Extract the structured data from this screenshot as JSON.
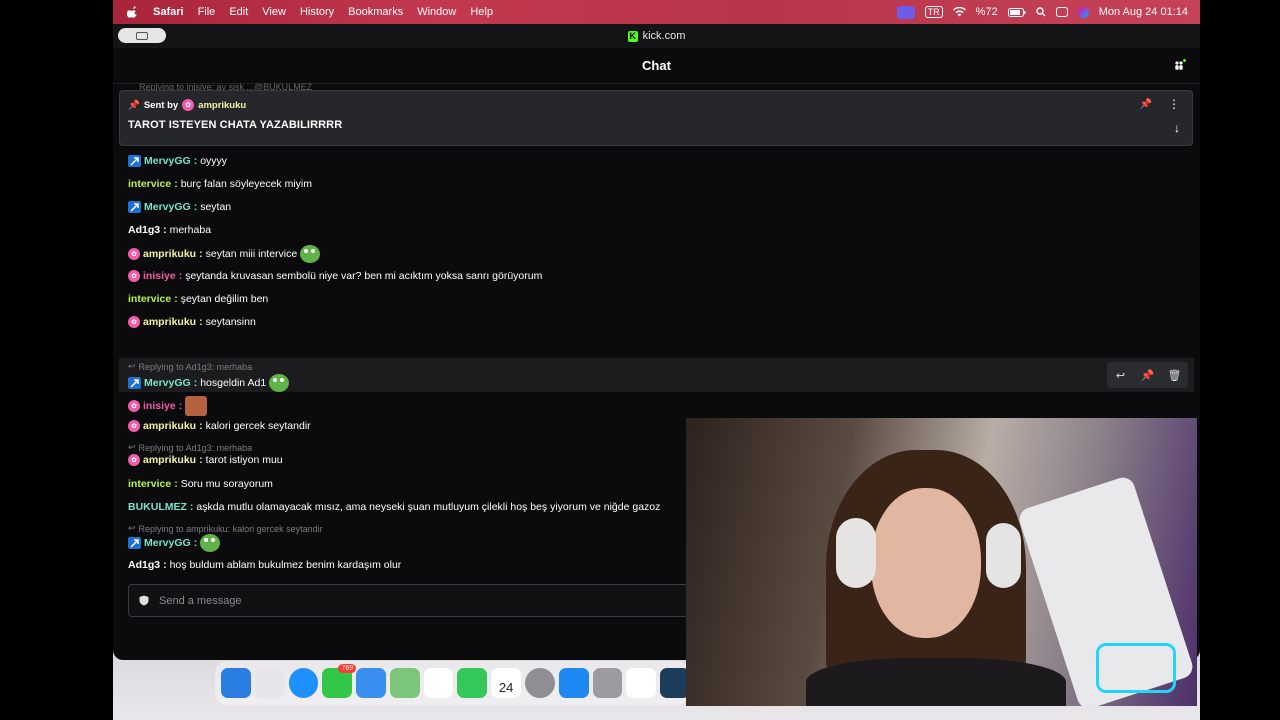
{
  "menubar": {
    "app": "Safari",
    "items": [
      "File",
      "Edit",
      "View",
      "History",
      "Bookmarks",
      "Window",
      "Help"
    ],
    "battery": "%72",
    "input_source": "TR",
    "datetime": "Mon Aug 24  01:14"
  },
  "browser": {
    "url": "kick.com",
    "logo_letter": "K"
  },
  "chat": {
    "title": "Chat",
    "ghost_reply": "Replying to inisiye: ay şişk ...@BUKULMEZ",
    "pinned": {
      "sent_by_label": "Sent by",
      "sender": "amprikuku",
      "message": "TAROT ISTEYEN CHATA YAZABILIRRRR"
    },
    "messages": [
      {
        "user": "MervyGG",
        "badge": "vip",
        "color": "#7be3c4",
        "text": "oyyyy"
      },
      {
        "user": "intervice",
        "badge": "",
        "color": "#b7f24a",
        "text": "burç falan söyleyecek miyim"
      },
      {
        "user": "MervyGG",
        "badge": "vip",
        "color": "#7be3c4",
        "text": "seytan"
      },
      {
        "user": "Ad1g3",
        "badge": "",
        "color": "#ffffff",
        "text": "merhaba"
      },
      {
        "user": "amprikuku",
        "badge": "pink",
        "color": "#f4f4a8",
        "text": "seytan miii intervice"
      },
      {
        "user": "inisiye",
        "badge": "pink",
        "color": "#f25caa",
        "text": "şeytanda kruvasan sembolü niye var? ben mi acıktım yoksa sanrı görüyorum"
      },
      {
        "user": "intervice",
        "badge": "",
        "color": "#b7f24a",
        "text": "şeytan değilim ben"
      },
      {
        "user": "amprikuku",
        "badge": "pink",
        "color": "#f4f4a8",
        "text": "seytansinn"
      },
      {
        "user": "MervyGG",
        "badge": "vip",
        "color": "#7be3c4",
        "text": "hosgeldin Ad1",
        "reply": "Replying to Ad1g3: merhaba"
      },
      {
        "user": "inisiye",
        "badge": "pink",
        "color": "#f25caa",
        "text": ""
      },
      {
        "user": "amprikuku",
        "badge": "pink",
        "color": "#f4f4a8",
        "text": "kalori gercek seytandir"
      },
      {
        "user": "amprikuku",
        "badge": "pink",
        "color": "#f4f4a8",
        "text": "tarot istiyon muu",
        "reply": "Replying to Ad1g3: merhaba"
      },
      {
        "user": "intervice",
        "badge": "",
        "color": "#b7f24a",
        "text": "Soru mu sorayorum"
      },
      {
        "user": "BUKULMEZ",
        "badge": "",
        "color": "#7be3c4",
        "text": "aşkda mutlu olamayacak mısız, ama neyseki şuan mutluyum çilekli hoş beş yiyorum ve niğde gazoz"
      },
      {
        "user": "MervyGG",
        "badge": "vip",
        "color": "#7be3c4",
        "text": "",
        "reply": "Replying to amprikuku: kalori gercek seytandir"
      },
      {
        "user": "Ad1g3",
        "badge": "",
        "color": "#ffffff",
        "text": "hoş buldum ablam bukulmez benim kardaşım olur"
      }
    ],
    "compose_placeholder": "Send a message"
  },
  "dock": {
    "calendar_day": "24",
    "messages_badge": "769"
  },
  "colors": {
    "kick_green": "#53fc18",
    "background": "#0b0b0d"
  }
}
